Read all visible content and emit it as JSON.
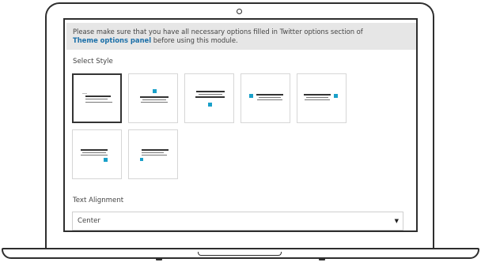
{
  "notice": {
    "line1": "Please make sure that you have all necessary options filled in Twitter options section of",
    "link_text": "Theme options panel",
    "line2_suffix": " before using this module."
  },
  "select_style": {
    "label": "Select Style",
    "options": [
      {
        "id": "style-1",
        "selected": true,
        "dot": "none"
      },
      {
        "id": "style-2",
        "selected": false,
        "dot": "top-center"
      },
      {
        "id": "style-3",
        "selected": false,
        "dot": "bottom-center"
      },
      {
        "id": "style-4",
        "selected": false,
        "dot": "left-center"
      },
      {
        "id": "style-5",
        "selected": false,
        "dot": "right-center"
      },
      {
        "id": "style-6",
        "selected": false,
        "dot": "bottom-right"
      },
      {
        "id": "style-7",
        "selected": false,
        "dot": "bottom-left"
      }
    ]
  },
  "text_alignment": {
    "label": "Text Alignment",
    "value": "Center",
    "arrow": "▼"
  },
  "colors": {
    "accent": "#1aa0c9",
    "link": "#1b6fa8",
    "notice_bg": "#e6e6e6"
  }
}
